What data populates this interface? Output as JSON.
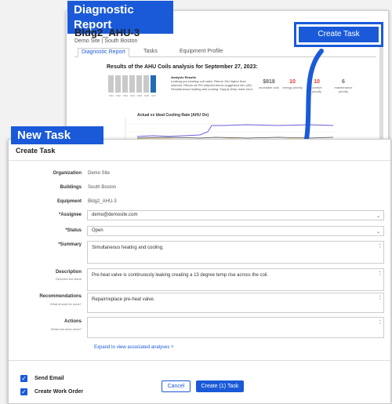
{
  "diagnostic": {
    "banner": "Diagnostic Report",
    "title": "Bldg2_AHU-3",
    "subtitle": "Demo Site | South Boston",
    "create_task_label": "Create Task",
    "tabs": [
      "Diagnostic Report",
      "Tasks",
      "Equipment Profile"
    ],
    "results_title": "Results of the AHU Coils analysis for September 27, 2023:",
    "day_labels": [
      "9/21",
      "9/22",
      "9/23",
      "9/24",
      "9/25",
      "9/26",
      "9/27"
    ],
    "analysis_heading": "Analysis Results",
    "analysis_text": "Leaking pre-heating coil valve. Return SAI higher than setpoint. Return air RH setpoint below suggested min (40). Simultaneous heating and cooling. Supply temp reset error.",
    "metrics": [
      {
        "value": "$818",
        "label": "avoidable cost",
        "color": "#222222"
      },
      {
        "value": "10",
        "label": "energy priority",
        "color": "#e0392b"
      },
      {
        "value": "10",
        "label": "comfort priority",
        "color": "#e0392b"
      },
      {
        "value": "6",
        "label": "maintenance priority",
        "color": "#222222"
      }
    ],
    "chart_title": "Actual vs Ideal Cooling Rate (AHU On)"
  },
  "new_task": {
    "banner": "New Task",
    "form_title": "Create Task",
    "organization_label": "Organization",
    "organization_value": "Demo Site",
    "buildings_label": "Buildings",
    "buildings_value": "South Boston",
    "equipment_label": "Equipment",
    "equipment_value": "Bldg2_AHU-3",
    "assignee_label": "*Assignee",
    "assignee_value": "demo@demosite.com",
    "status_label": "*Status",
    "status_value": "Open",
    "summary_label": "*Summary",
    "summary_value": "Simultaneous heating and cooling.",
    "description_label": "Description",
    "description_hint": "Describe the issue",
    "description_value": "Pre-heat valve is continuously leaking creating a 13 degree temp rise across the coil.",
    "recommendations_label": "Recommendations",
    "recommendations_hint": "What should be done?",
    "recommendations_value": "Repair/replace pre-heat valve.",
    "actions_label": "Actions",
    "actions_hint": "What has been done?",
    "actions_value": "",
    "expand_link": "Expand to view associated analyses ˅",
    "send_email_label": "Send Email",
    "send_email_checked": true,
    "create_work_order_label": "Create Work Order",
    "create_work_order_checked": true,
    "cancel_label": "Cancel",
    "create_button_label": "Create (1) Task"
  },
  "colors": {
    "accent": "#1a5ad9",
    "bar": "#c9c9c9",
    "bar_selected": "#1e6db5"
  }
}
